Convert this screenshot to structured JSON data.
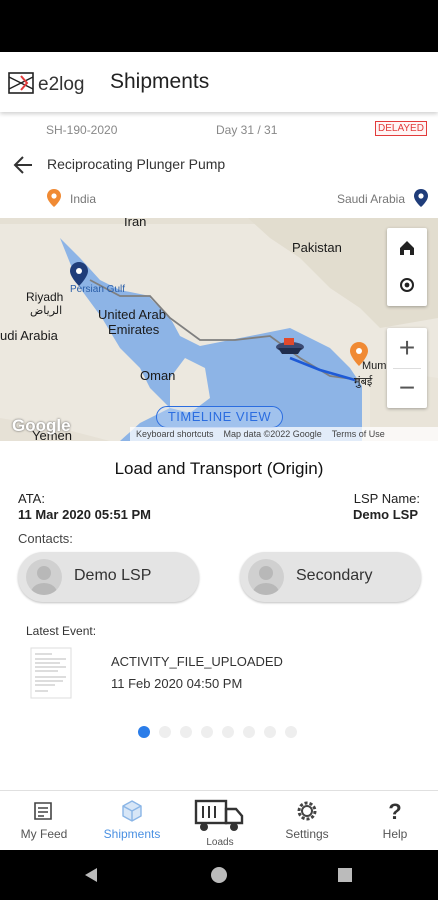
{
  "app": {
    "logo_text": "e2log",
    "title": "Shipments"
  },
  "shipment": {
    "id": "SH-190-2020",
    "day": "Day 31 / 31",
    "status": "DELAYED",
    "product": "Reciprocating Plunger Pump",
    "origin": "India",
    "destination": "Saudi Arabia"
  },
  "map": {
    "labels": {
      "iran": "Iran",
      "pakistan": "Pakistan",
      "riyadh": "Riyadh",
      "riyadh_ar": "الرياض",
      "saudi": "udi Arabia",
      "uae1": "United Arab",
      "uae2": "Emirates",
      "oman": "Oman",
      "yemen": "Yemen",
      "persian_gulf": "Persian Gulf",
      "mumbai": "Mumbai",
      "mumbai_local": "मुंबई"
    },
    "timeline_button": "TIMELINE VIEW",
    "google": "Google",
    "attribution": [
      "Keyboard shortcuts",
      "Map data ©2022 Google",
      "Terms of Use"
    ],
    "controls": {
      "home": "home-icon",
      "locate": "target-icon",
      "zoom_in": "+",
      "zoom_out": "−"
    }
  },
  "leg": {
    "title": "Load and Transport (Origin)",
    "ata_label": "ATA:",
    "ata_value": "11 Mar 2020 05:51 PM",
    "lsp_label": "LSP Name:",
    "lsp_value": "Demo LSP",
    "contacts_label": "Contacts:",
    "contacts": [
      "Demo LSP",
      "Secondary"
    ],
    "latest_label": "Latest Event:",
    "event_name": "ACTIVITY_FILE_UPLOADED",
    "event_time": "11 Feb 2020 04:50 PM",
    "page_index": 1,
    "page_count": 8
  },
  "nav": [
    {
      "label": "My Feed",
      "icon": "feed-icon"
    },
    {
      "label": "Shipments",
      "icon": "box-icon",
      "active": true
    },
    {
      "label": "Loads",
      "icon": "truck-icon"
    },
    {
      "label": "Settings",
      "icon": "gear-icon"
    },
    {
      "label": "Help",
      "icon": "help-icon"
    }
  ],
  "colors": {
    "accent": "#2b7de9",
    "delayed": "#e23b3b",
    "origin_pin": "#f08a34",
    "dest_pin": "#1f3d7a",
    "sea": "#8db4e6"
  }
}
